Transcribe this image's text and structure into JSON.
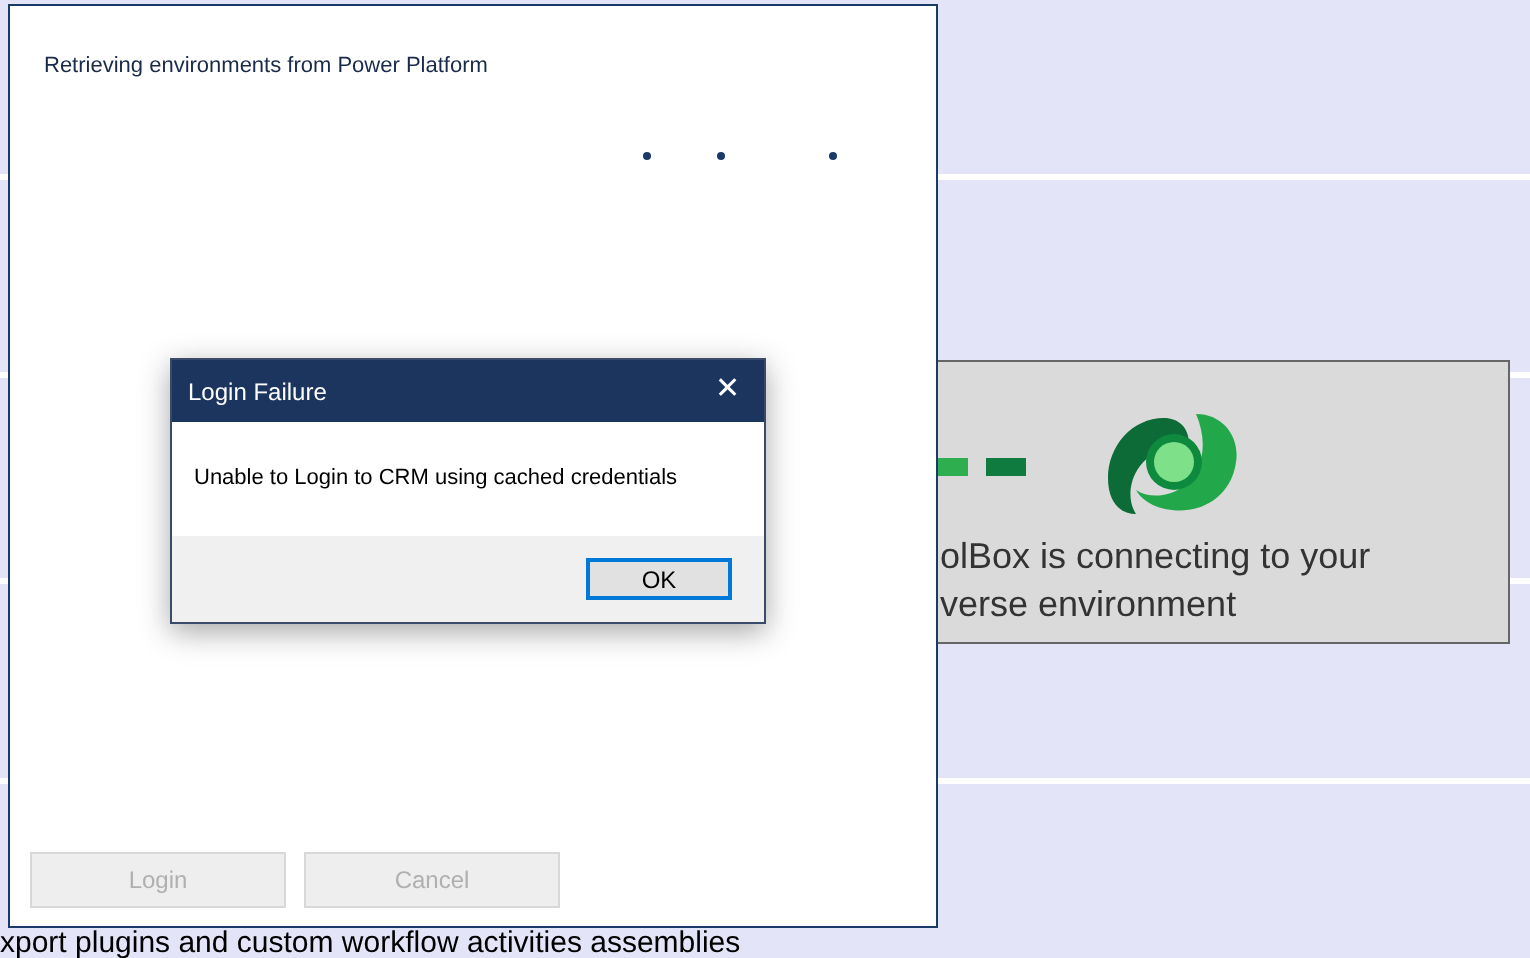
{
  "background": {
    "footer_text": "xport plugins and custom workflow activities assemblies"
  },
  "splash": {
    "lines": [
      "olBox is connecting to your",
      "verse environment"
    ]
  },
  "login_window": {
    "status": "Retrieving environments from Power Platform",
    "buttons": [
      {
        "label": "Login",
        "disabled": true
      },
      {
        "label": "Cancel",
        "disabled": true
      }
    ]
  },
  "dialog": {
    "title": "Login Failure",
    "close": "✕",
    "message": "Unable to Login to CRM using cached credentials",
    "buttons": [
      {
        "label": "OK",
        "focused": true
      }
    ]
  }
}
